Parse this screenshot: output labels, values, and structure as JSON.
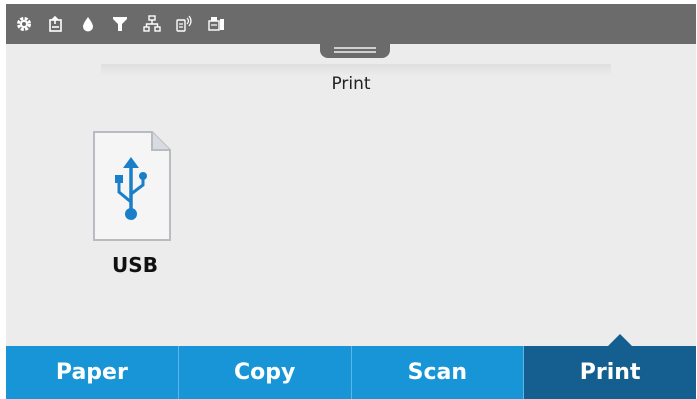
{
  "status_icons": [
    "gear-icon",
    "copy-status-icon",
    "ink-icon",
    "paper-funnel-icon",
    "network-icon",
    "wifi-direct-icon",
    "printer-status-icon"
  ],
  "page_title": "Print",
  "sources": [
    {
      "label": "USB",
      "icon": "usb-icon",
      "accent": "#1a7fc8"
    }
  ],
  "tabs": [
    {
      "label": "Paper",
      "active": false
    },
    {
      "label": "Copy",
      "active": false
    },
    {
      "label": "Scan",
      "active": false
    },
    {
      "label": "Print",
      "active": true
    }
  ],
  "colors": {
    "tab_bg": "#1795d6",
    "tab_active_bg": "#145f8f",
    "status_bar": "#6b6b6b",
    "background": "#ececec"
  }
}
